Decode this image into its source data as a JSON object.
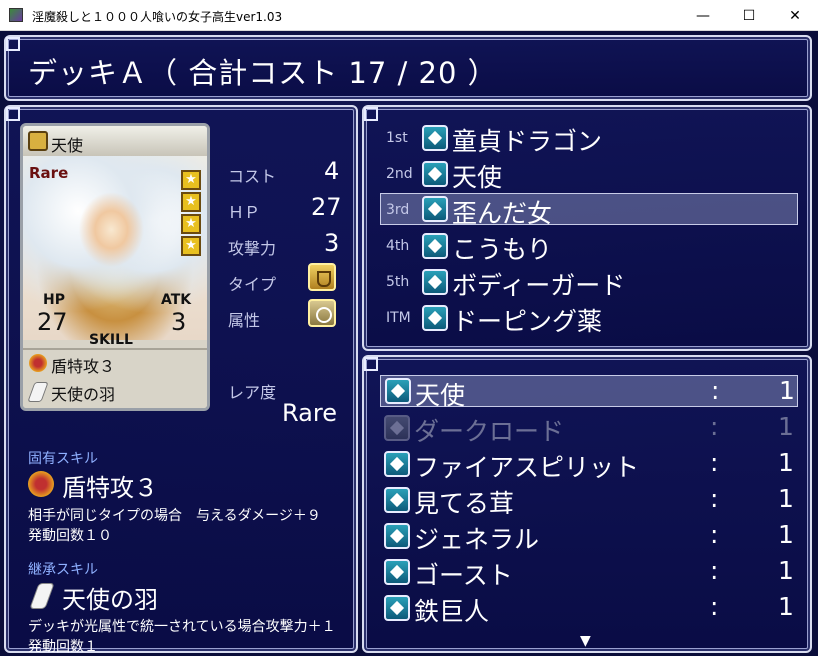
{
  "window": {
    "title": "淫魔殺しと１０００人喰いの女子高生ver1.03",
    "minimize": "—",
    "maximize": "☐",
    "close": "✕"
  },
  "header": {
    "title": "デッキＡ（ 合計コスト 17 / 20 ）"
  },
  "card": {
    "type_label": "天使",
    "rarity_badge": "Rare",
    "hp_label": "HP",
    "hp": "27",
    "atk_label": "ATK",
    "atk": "3",
    "skill_label": "SKILL",
    "skill1": "盾特攻３",
    "skill2": "天使の羽",
    "stars": 4
  },
  "stats": {
    "cost_label": "コスト",
    "cost": "4",
    "hp_label": "ＨＰ",
    "hp": "27",
    "atk_label": "攻撃力",
    "atk": "3",
    "type_label": "タイプ",
    "attr_label": "属性",
    "rarity_label": "レア度",
    "rarity": "Rare"
  },
  "skills": {
    "innate_label": "固有スキル",
    "innate_name": "盾特攻３",
    "innate_desc1": "相手が同じタイプの場合　与えるダメージ＋９",
    "innate_desc2": "発動回数１０",
    "inherit_label": "継承スキル",
    "inherit_name": "天使の羽",
    "inherit_desc1": "デッキが光属性で統一されている場合攻撃力＋１",
    "inherit_desc2": "発動回数１"
  },
  "deck": [
    {
      "slot": "1st",
      "name": "童貞ドラゴン"
    },
    {
      "slot": "2nd",
      "name": "天使"
    },
    {
      "slot": "3rd",
      "name": "歪んだ女"
    },
    {
      "slot": "4th",
      "name": "こうもり"
    },
    {
      "slot": "5th",
      "name": "ボディーガード"
    },
    {
      "slot": "ITM",
      "name": "ドーピング薬"
    }
  ],
  "inventory": [
    {
      "name": "天使",
      "sep": ":",
      "count": "1"
    },
    {
      "name": "ダークロード",
      "sep": ":",
      "count": "1"
    },
    {
      "name": "ファイアスピリット",
      "sep": ":",
      "count": "1"
    },
    {
      "name": "見てる茸",
      "sep": ":",
      "count": "1"
    },
    {
      "name": "ジェネラル",
      "sep": ":",
      "count": "1"
    },
    {
      "name": "ゴースト",
      "sep": ":",
      "count": "1"
    },
    {
      "name": "鉄巨人",
      "sep": ":",
      "count": "1"
    }
  ],
  "scroll": {
    "arrow": "▼"
  }
}
